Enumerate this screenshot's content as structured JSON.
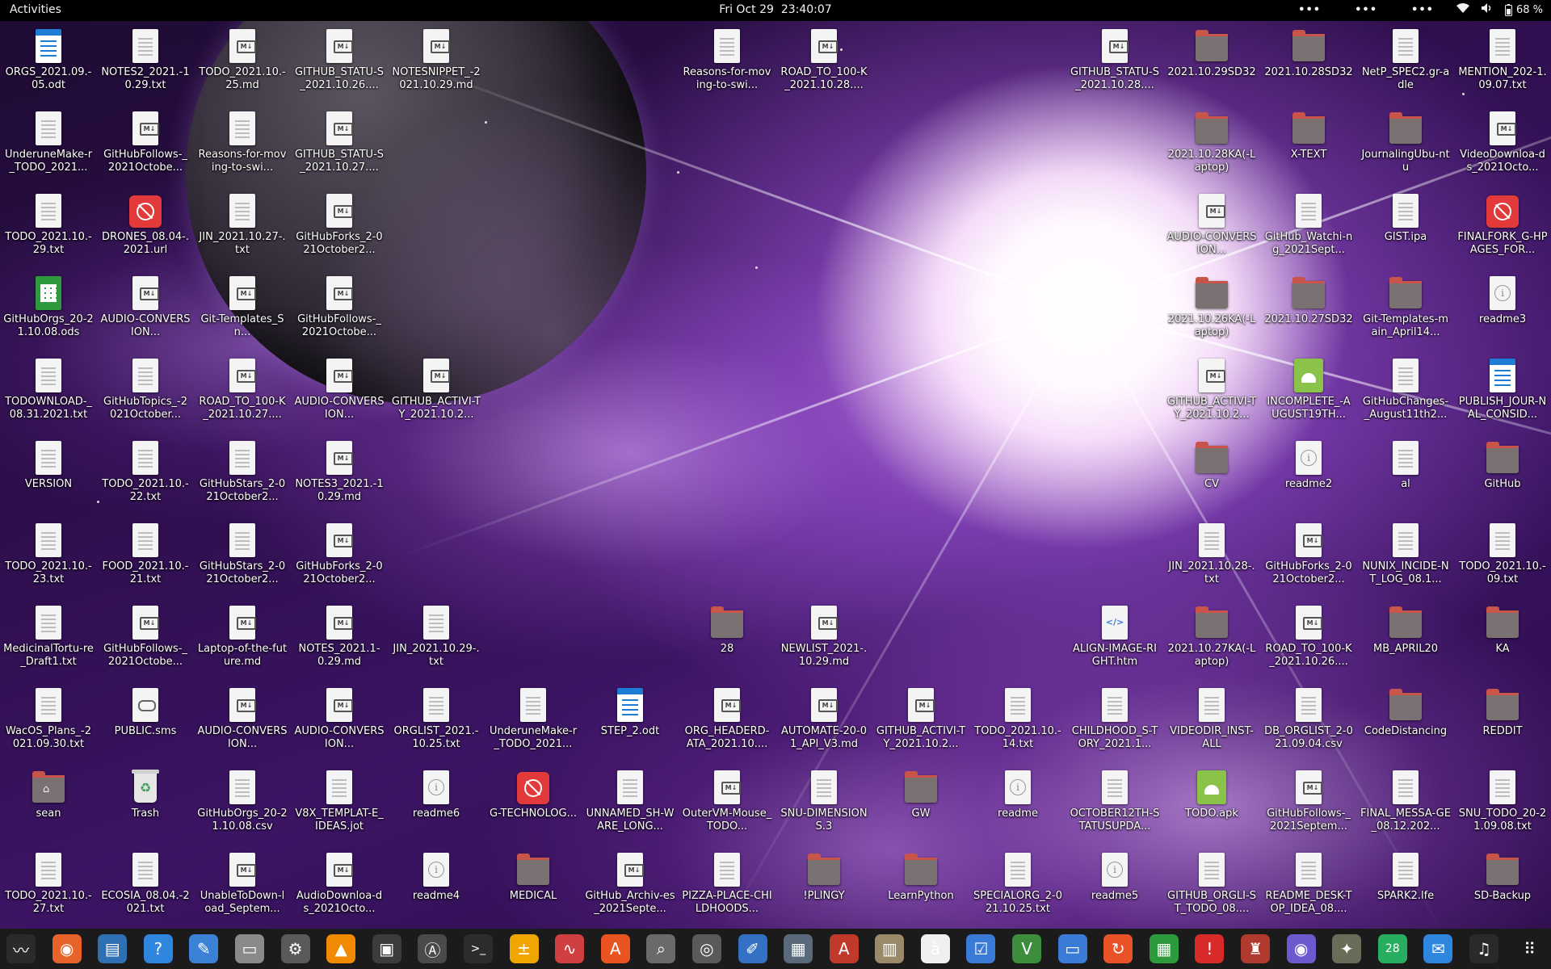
{
  "topbar": {
    "activities": "Activities",
    "date": "Fri Oct 29",
    "time": "23:40:07",
    "indicator1": "•••",
    "indicator2": "•••",
    "indicator3": "•••",
    "battery": "68 %"
  },
  "desktop_icons": [
    {
      "label": "ORGS_2021.09.-05.odt",
      "type": "writer"
    },
    {
      "label": "NOTES2_2021.-10.29.txt",
      "type": "doc"
    },
    {
      "label": "TODO_2021.10.-25.md",
      "type": "md"
    },
    {
      "label": "GITHUB_STATU-S_2021.10.26....",
      "type": "md"
    },
    {
      "label": "NOTESNIPPET_-2021.10.29.md",
      "type": "md"
    },
    {
      "label": "Reasons-for-moving-to-swi...",
      "type": "doc"
    },
    {
      "label": "ROAD_TO_100-K_2021.10.28....",
      "type": "md"
    },
    {
      "label": "GITHUB_STATU-S_2021.10.28....",
      "type": "md"
    },
    {
      "label": "2021.10.29SD32",
      "type": "folder"
    },
    {
      "label": "2021.10.28SD32",
      "type": "folder"
    },
    {
      "label": "NetP_SPEC2.gr-adle",
      "type": "doc"
    },
    {
      "label": "MENTION_202-1.09.07.txt",
      "type": "doc"
    },
    {
      "label": "UnderuneMake-r_TODO_2021...",
      "type": "doc"
    },
    {
      "label": "GitHubFollows-_2021Octobe...",
      "type": "md"
    },
    {
      "label": "Reasons-for-moving-to-swi...",
      "type": "doc"
    },
    {
      "label": "GITHUB_STATU-S_2021.10.27....",
      "type": "md"
    },
    {
      "label": "2021.10.28KA(-Laptop)",
      "type": "folder"
    },
    {
      "label": "X-TEXT",
      "type": "folder"
    },
    {
      "label": "JournalingUbu-ntu",
      "type": "folder"
    },
    {
      "label": "VideoDownloa-ds_2021Octo...",
      "type": "md"
    },
    {
      "label": "TODO_2021.10.-29.txt",
      "type": "doc"
    },
    {
      "label": "DRONES_08.04-.2021.url",
      "type": "blocked"
    },
    {
      "label": "JIN_2021.10.27-.txt",
      "type": "doc"
    },
    {
      "label": "GitHubForks_2-021October2...",
      "type": "md"
    },
    {
      "label": "AUDIO-CONVERSION...",
      "type": "md"
    },
    {
      "label": "GitHub_Watchi-ng_2021Sept...",
      "type": "doc"
    },
    {
      "label": "GIST.ipa",
      "type": "doc"
    },
    {
      "label": "FINALFORK_G-HPAGES_FOR...",
      "type": "blocked"
    },
    {
      "label": "GitHubOrgs_20-21.10.08.ods",
      "type": "sheet"
    },
    {
      "label": "AUDIO-CONVERSION...",
      "type": "md"
    },
    {
      "label": "Git-Templates_Sn...",
      "type": "md"
    },
    {
      "label": "GitHubFollows-_2021Octobe...",
      "type": "md"
    },
    {
      "label": "2021.10.26KA(-Laptop)",
      "type": "folder"
    },
    {
      "label": "2021.10.27SD32",
      "type": "folder"
    },
    {
      "label": "Git-Templates-main_April14...",
      "type": "folder"
    },
    {
      "label": "readme3",
      "type": "info"
    },
    {
      "label": "TODOWNLOAD-_08.31.2021.txt",
      "type": "doc"
    },
    {
      "label": "GitHubTopics_-2021October...",
      "type": "doc"
    },
    {
      "label": "ROAD_TO_100-K_2021.10.27....",
      "type": "md"
    },
    {
      "label": "AUDIO-CONVERSION...",
      "type": "md"
    },
    {
      "label": "GITHUB_ACTIVI-TY_2021.10.2...",
      "type": "md"
    },
    {
      "label": "GITHUB_ACTIVI-TY_2021.10.2...",
      "type": "md"
    },
    {
      "label": "INCOMPLETE_-AUGUST19TH...",
      "type": "apk"
    },
    {
      "label": "GitHubChanges-_August11th2...",
      "type": "doc"
    },
    {
      "label": "PUBLISH_JOUR-NAL_CONSID...",
      "type": "writer"
    },
    {
      "label": "VERSION",
      "type": "doc"
    },
    {
      "label": "TODO_2021.10.-22.txt",
      "type": "doc"
    },
    {
      "label": "GitHubStars_2-021October2...",
      "type": "doc"
    },
    {
      "label": "NOTES3_2021.-10.29.md",
      "type": "md"
    },
    {
      "label": "CV",
      "type": "folder"
    },
    {
      "label": "readme2",
      "type": "info"
    },
    {
      "label": "al",
      "type": "doc"
    },
    {
      "label": "GitHub",
      "type": "folder"
    },
    {
      "label": "TODO_2021.10.-23.txt",
      "type": "doc"
    },
    {
      "label": "FOOD_2021.10.-21.txt",
      "type": "doc"
    },
    {
      "label": "GitHubStars_2-021October2...",
      "type": "doc"
    },
    {
      "label": "GitHubForks_2-021October2...",
      "type": "md"
    },
    {
      "label": "JIN_2021.10.28-.txt",
      "type": "doc"
    },
    {
      "label": "GitHubForks_2-021October2...",
      "type": "md"
    },
    {
      "label": "NUNIX_INCIDE-NT_LOG_08.1...",
      "type": "doc"
    },
    {
      "label": "TODO_2021.10.-09.txt",
      "type": "doc"
    },
    {
      "label": "MedicinalTortu-re_Draft1.txt",
      "type": "doc"
    },
    {
      "label": "GitHubFollows-_2021Octobe...",
      "type": "md"
    },
    {
      "label": "Laptop-of-the-future.md",
      "type": "md"
    },
    {
      "label": "NOTES_2021.1-0.29.md",
      "type": "md"
    },
    {
      "label": "JIN_2021.10.29-.txt",
      "type": "doc"
    },
    {
      "label": "28",
      "type": "folder"
    },
    {
      "label": "NEWLIST_2021-.10.29.md",
      "type": "md"
    },
    {
      "label": "ALIGN-IMAGE-RIGHT.htm",
      "type": "htm"
    },
    {
      "label": "2021.10.27KA(-Laptop)",
      "type": "folder"
    },
    {
      "label": "ROAD_TO_100-K_2021.10.26....",
      "type": "md"
    },
    {
      "label": "MB_APRIL20",
      "type": "folder"
    },
    {
      "label": "KA",
      "type": "folder"
    },
    {
      "label": "WacOS_Plans_-2021.09.30.txt",
      "type": "doc"
    },
    {
      "label": "PUBLIC.sms",
      "type": "pad"
    },
    {
      "label": "AUDIO-CONVERSION...",
      "type": "md"
    },
    {
      "label": "AUDIO-CONVERSION...",
      "type": "md"
    },
    {
      "label": "ORGLIST_2021.-10.25.txt",
      "type": "doc"
    },
    {
      "label": "UnderuneMake-r_TODO_2021...",
      "type": "doc"
    },
    {
      "label": "STEP_2.odt",
      "type": "writer"
    },
    {
      "label": "ORG_HEADERD-ATA_2021.10....",
      "type": "md"
    },
    {
      "label": "AUTOMATE-20-01_API_V3.md",
      "type": "md"
    },
    {
      "label": "GITHUB_ACTIVI-TY_2021.10.2...",
      "type": "md"
    },
    {
      "label": "TODO_2021.10.-14.txt",
      "type": "doc"
    },
    {
      "label": "CHILDHOOD_S-TORY_2021.1...",
      "type": "doc"
    },
    {
      "label": "VIDEODIR_INST-ALL",
      "type": "doc"
    },
    {
      "label": "DB_ORGLIST_2-021.09.04.csv",
      "type": "doc"
    },
    {
      "label": "CodeDistancing",
      "type": "folder"
    },
    {
      "label": "REDDIT",
      "type": "folder"
    },
    {
      "label": "sean",
      "type": "home"
    },
    {
      "label": "Trash",
      "type": "trash"
    },
    {
      "label": "GitHubOrgs_20-21.10.08.csv",
      "type": "doc"
    },
    {
      "label": "V8X_TEMPLAT-E_IDEAS.jot",
      "type": "doc"
    },
    {
      "label": "readme6",
      "type": "info"
    },
    {
      "label": "G-TECHNOLOG...",
      "type": "blocked"
    },
    {
      "label": "UNNAMED_SH-WARE_LONG...",
      "type": "doc"
    },
    {
      "label": "OuterVM-Mouse_TODO...",
      "type": "md"
    },
    {
      "label": "SNU-DIMENSIONS.3",
      "type": "doc"
    },
    {
      "label": "GW",
      "type": "folder"
    },
    {
      "label": "readme",
      "type": "info"
    },
    {
      "label": "OCTOBER12TH-STATUSUPDA...",
      "type": "doc"
    },
    {
      "label": "TODO.apk",
      "type": "apk"
    },
    {
      "label": "GitHubFollows-_2021Septem...",
      "type": "md"
    },
    {
      "label": "FINAL_MESSA-GE_08.12.202...",
      "type": "doc"
    },
    {
      "label": "SNU_TODO_20-21.09.08.txt",
      "type": "doc"
    },
    {
      "label": "TODO_2021.10.-27.txt",
      "type": "doc"
    },
    {
      "label": "ECOSIA_08.04.-2021.txt",
      "type": "doc"
    },
    {
      "label": "UnableToDown-load_Septem...",
      "type": "md"
    },
    {
      "label": "AudioDownloa-ds_2021Octo...",
      "type": "md"
    },
    {
      "label": "readme4",
      "type": "info"
    },
    {
      "label": "MEDICAL",
      "type": "folder"
    },
    {
      "label": "GitHub_Archiv-es_2021Septe...",
      "type": "md"
    },
    {
      "label": "PIZZA-PLACE-CHILDHOODS...",
      "type": "doc"
    },
    {
      "label": "!PLINGY",
      "type": "folder"
    },
    {
      "label": "LearnPython",
      "type": "folder"
    },
    {
      "label": "SPECIALORG_2-021.10.25.txt",
      "type": "doc"
    },
    {
      "label": "readme5",
      "type": "info"
    },
    {
      "label": "GITHUB_ORGLI-ST_TODO_08....",
      "type": "doc"
    },
    {
      "label": "README_DESK-TOP_IDEA_08....",
      "type": "doc"
    },
    {
      "label": "SPARK2.lfe",
      "type": "doc"
    },
    {
      "label": "SD-Backup",
      "type": "folder"
    }
  ],
  "dock": [
    {
      "name": "system-monitor-icon",
      "glyph": "〰",
      "color": "#2b2b2b"
    },
    {
      "name": "firefox-icon",
      "glyph": "◉",
      "color": "#e8632a"
    },
    {
      "name": "document-viewer-icon",
      "glyph": "▤",
      "color": "#2f6fb3"
    },
    {
      "name": "help-icon",
      "glyph": "?",
      "color": "#2e86de"
    },
    {
      "name": "text-editor-icon",
      "glyph": "✎",
      "color": "#3b82d6"
    },
    {
      "name": "files-icon",
      "glyph": "▭",
      "color": "#8a8a8a"
    },
    {
      "name": "settings-icon",
      "glyph": "⚙",
      "color": "#5a5a5a"
    },
    {
      "name": "vlc-icon",
      "glyph": "▲",
      "color": "#f08a00"
    },
    {
      "name": "terminal-green-icon",
      "glyph": "▣",
      "color": "#3c3c3c"
    },
    {
      "name": "software-updater-icon",
      "glyph": "Ⓐ",
      "color": "#4a4a4a"
    },
    {
      "name": "terminal-icon",
      "glyph": ">_",
      "color": "#2c2c2c"
    },
    {
      "name": "calculator-icon",
      "glyph": "±",
      "color": "#f0a500"
    },
    {
      "name": "graph-icon",
      "glyph": "∿",
      "color": "#d04040"
    },
    {
      "name": "app-store-icon",
      "glyph": "A",
      "color": "#e95420"
    },
    {
      "name": "image-viewer-icon",
      "glyph": "⌕",
      "color": "#6a6a6a"
    },
    {
      "name": "disks-icon",
      "glyph": "◎",
      "color": "#5a5a5a"
    },
    {
      "name": "drawing-icon",
      "glyph": "✐",
      "color": "#3470c4"
    },
    {
      "name": "screenshot-icon",
      "glyph": "▦",
      "color": "#5a6a7a"
    },
    {
      "name": "pdf-icon",
      "glyph": "A",
      "color": "#c0392b"
    },
    {
      "name": "archive-icon",
      "glyph": "▥",
      "color": "#9a8a6a"
    },
    {
      "name": "character-map-icon",
      "glyph": "à",
      "color": "#f0f0f0"
    },
    {
      "name": "tasks-icon",
      "glyph": "☑",
      "color": "#3b7bd8"
    },
    {
      "name": "vim-icon",
      "glyph": "V",
      "color": "#3c8d3c"
    },
    {
      "name": "remote-desktop-icon",
      "glyph": "▭",
      "color": "#3b7bd8"
    },
    {
      "name": "backup-icon",
      "glyph": "↻",
      "color": "#e8532a"
    },
    {
      "name": "spreadsheet-icon",
      "glyph": "▦",
      "color": "#2e9a3e"
    },
    {
      "name": "warning-icon",
      "glyph": "!",
      "color": "#d92a2a"
    },
    {
      "name": "game-icon",
      "glyph": "♜",
      "color": "#b03a2e"
    },
    {
      "name": "camera-icon",
      "glyph": "◉",
      "color": "#6a5acd"
    },
    {
      "name": "gimp-icon",
      "glyph": "✦",
      "color": "#6b6b5a"
    },
    {
      "name": "calendar-icon",
      "glyph": "28",
      "color": "#27ae60"
    },
    {
      "name": "thunderbird-icon",
      "glyph": "✉",
      "color": "#2e86de"
    },
    {
      "name": "music-icon",
      "glyph": "♫",
      "color": "#2a2a2a"
    },
    {
      "name": "show-apps-icon",
      "glyph": "⠿",
      "color": "#1b1b1b"
    }
  ]
}
